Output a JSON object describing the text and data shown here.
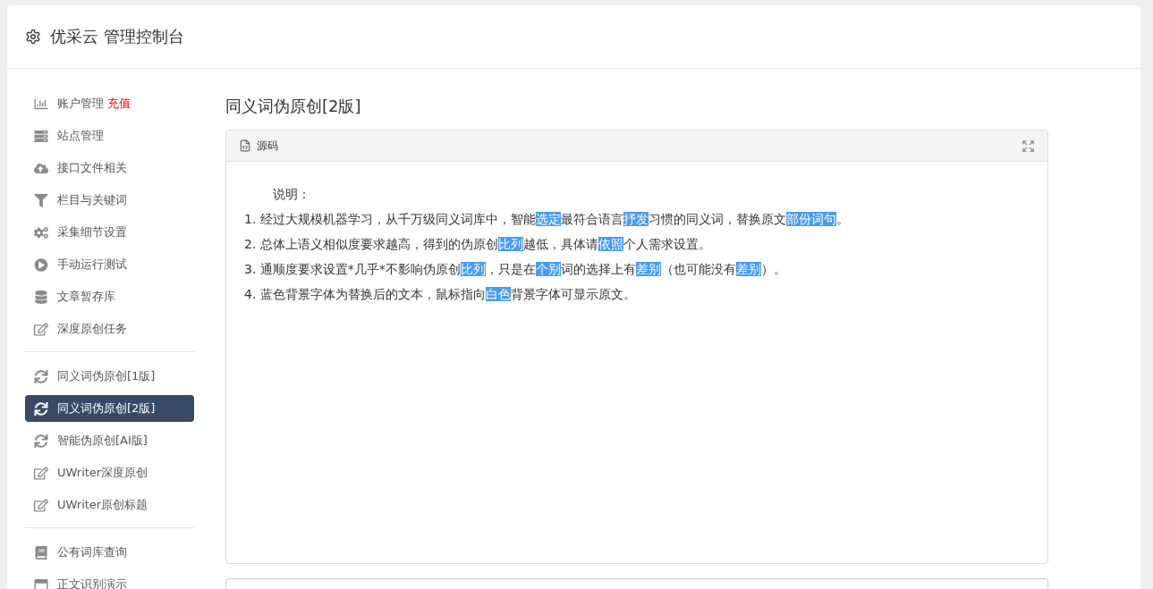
{
  "header": {
    "title": "优采云 管理控制台"
  },
  "sidebar": {
    "groups": [
      {
        "items": [
          {
            "label": "账户管理",
            "badge": "充值",
            "selected": false
          },
          {
            "label": "站点管理",
            "selected": false
          },
          {
            "label": "接口文件相关",
            "selected": false
          },
          {
            "label": "栏目与关键词",
            "selected": false
          },
          {
            "label": "采集细节设置",
            "selected": false
          },
          {
            "label": "手动运行测试",
            "selected": false
          },
          {
            "label": "文章暂存库",
            "selected": false
          },
          {
            "label": "深度原创任务",
            "selected": false
          }
        ]
      },
      {
        "items": [
          {
            "label": "同义词伪原创[1版]",
            "selected": false
          },
          {
            "label": "同义词伪原创[2版]",
            "selected": true
          },
          {
            "label": "智能伪原创[AI版]",
            "selected": false
          },
          {
            "label": "UWriter深度原创",
            "selected": false
          },
          {
            "label": "UWriter原创标题",
            "selected": false
          }
        ]
      },
      {
        "items": [
          {
            "label": "公有词库查询",
            "selected": false
          },
          {
            "label": "正文识别演示",
            "selected": false
          }
        ]
      }
    ]
  },
  "main": {
    "title": "同义词伪原创[2版]",
    "editor": {
      "toolbar_label": "源码",
      "heading": "说明：",
      "lines": [
        [
          {
            "text": "1. 经过大规模机器学习，从千万级同义词库中，智能",
            "highlighted": false
          },
          {
            "text": "选定",
            "highlighted": true
          },
          {
            "text": "最符合语言",
            "highlighted": false
          },
          {
            "text": "抒发",
            "highlighted": true
          },
          {
            "text": "习惯的同义词，替换原文",
            "highlighted": false
          },
          {
            "text": "部份",
            "highlighted": true
          },
          {
            "text": "词句",
            "highlighted": true
          },
          {
            "text": "。",
            "highlighted": false
          }
        ],
        [
          {
            "text": "2. 总体上语义相似度要求越高，得到的伪原创",
            "highlighted": false
          },
          {
            "text": "比列",
            "highlighted": true
          },
          {
            "text": "越低，具体请",
            "highlighted": false
          },
          {
            "text": "依照",
            "highlighted": true
          },
          {
            "text": "个人需求设置。",
            "highlighted": false
          }
        ],
        [
          {
            "text": "3. 通顺度要求设置*几乎*不影响伪原创",
            "highlighted": false
          },
          {
            "text": "比列",
            "highlighted": true
          },
          {
            "text": "，只是在",
            "highlighted": false
          },
          {
            "text": "个别",
            "highlighted": true
          },
          {
            "text": "词的选择上有",
            "highlighted": false
          },
          {
            "text": "差别",
            "highlighted": true
          },
          {
            "text": "（也可能没有",
            "highlighted": false
          },
          {
            "text": "差别",
            "highlighted": true
          },
          {
            "text": "）。",
            "highlighted": false
          }
        ],
        [
          {
            "text": "4. 蓝色背景字体为替换后的文本，鼠标指向",
            "highlighted": false
          },
          {
            "text": "白色",
            "highlighted": true
          },
          {
            "text": "背景字体可显示原文。",
            "highlighted": false
          }
        ]
      ]
    }
  }
}
